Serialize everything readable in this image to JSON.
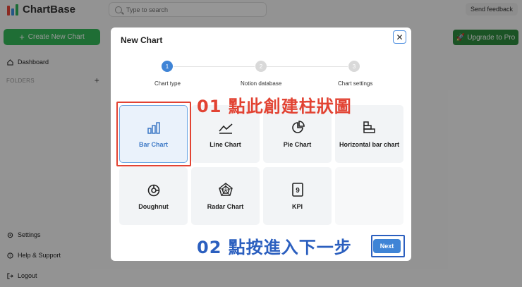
{
  "app": {
    "logo_text": "ChartBase",
    "search_placeholder": "Type to search",
    "feedback_label": "Send feedback",
    "create_label": "Create New Chart",
    "upgrade_label": "Upgrade to Pro",
    "nav": {
      "dashboard": "Dashboard",
      "folders": "FOLDERS",
      "settings": "Settings",
      "help": "Help & Support",
      "logout": "Logout"
    },
    "logo_colors": [
      "#e8463a",
      "#3b8fde",
      "#2fb45a"
    ]
  },
  "modal": {
    "title": "New Chart",
    "close_glyph": "✕",
    "steps": [
      {
        "number": "1",
        "label": "Chart type",
        "active": true
      },
      {
        "number": "2",
        "label": "Notion database",
        "active": false
      },
      {
        "number": "3",
        "label": "Chart settings",
        "active": false
      }
    ],
    "chart_types": [
      {
        "label": "Bar Chart",
        "icon": "bar-chart-icon",
        "selected": true
      },
      {
        "label": "Line Chart",
        "icon": "line-chart-icon",
        "selected": false
      },
      {
        "label": "Pie Chart",
        "icon": "pie-chart-icon",
        "selected": false
      },
      {
        "label": "Horizontal bar chart",
        "icon": "horizontal-bar-chart-icon",
        "selected": false
      },
      {
        "label": "Doughnut",
        "icon": "doughnut-icon",
        "selected": false
      },
      {
        "label": "Radar Chart",
        "icon": "radar-chart-icon",
        "selected": false
      },
      {
        "label": "KPI",
        "icon": "kpi-icon",
        "selected": false
      }
    ],
    "next_label": "Next"
  },
  "annotations": {
    "step1": "01 點此創建柱狀圖",
    "step2": "02 點按進入下一步"
  },
  "colors": {
    "active_step": "#3f84d6",
    "inactive_step": "#d9d9d9",
    "annotation_red": "#e24333",
    "annotation_blue": "#2b5fbf",
    "create_green": "#34b759"
  }
}
